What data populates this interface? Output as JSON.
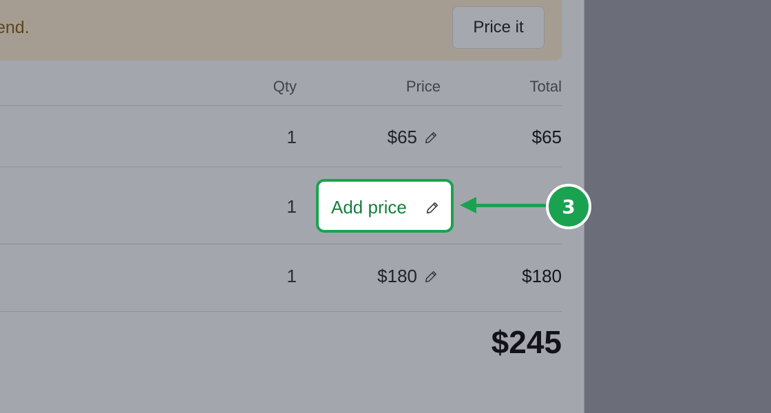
{
  "banner": {
    "text": "end.",
    "price_it_label": "Price it"
  },
  "table": {
    "headers": {
      "qty": "Qty",
      "price": "Price",
      "total": "Total"
    },
    "rows": [
      {
        "qty": "1",
        "price": "$65",
        "total": "$65"
      },
      {
        "qty": "1",
        "price": "",
        "total": ""
      },
      {
        "qty": "1",
        "price": "$180",
        "total": "$180"
      }
    ],
    "add_price_label": "Add price",
    "grand_total": "$245"
  },
  "callout": {
    "step_number": "3",
    "color": "#1aa251"
  },
  "icons": {
    "edit": "pencil-icon"
  }
}
